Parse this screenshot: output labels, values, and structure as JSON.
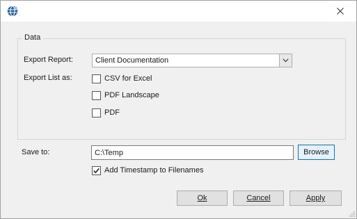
{
  "window": {
    "icon": "globe-app-icon",
    "close_icon": "close-x-icon"
  },
  "data_group": {
    "title": "Data",
    "export_report_label": "Export Report:",
    "export_report_value": "Client Documentation",
    "export_list_label": "Export List as:",
    "options": [
      {
        "label": "CSV for Excel",
        "checked": false
      },
      {
        "label": "PDF Landscape",
        "checked": false
      },
      {
        "label": "PDF",
        "checked": false
      }
    ]
  },
  "save": {
    "label": "Save to:",
    "path": "C:\\Temp",
    "browse_label": "Browse",
    "timestamp_label": "Add Timestamp to Filenames",
    "timestamp_checked": true
  },
  "buttons": {
    "ok": "Ok",
    "cancel": "Cancel",
    "apply": "Apply"
  },
  "colors": {
    "accent": "#0078d7",
    "window_bg": "#f0f0f0",
    "icon_blue": "#1f5b9b"
  }
}
